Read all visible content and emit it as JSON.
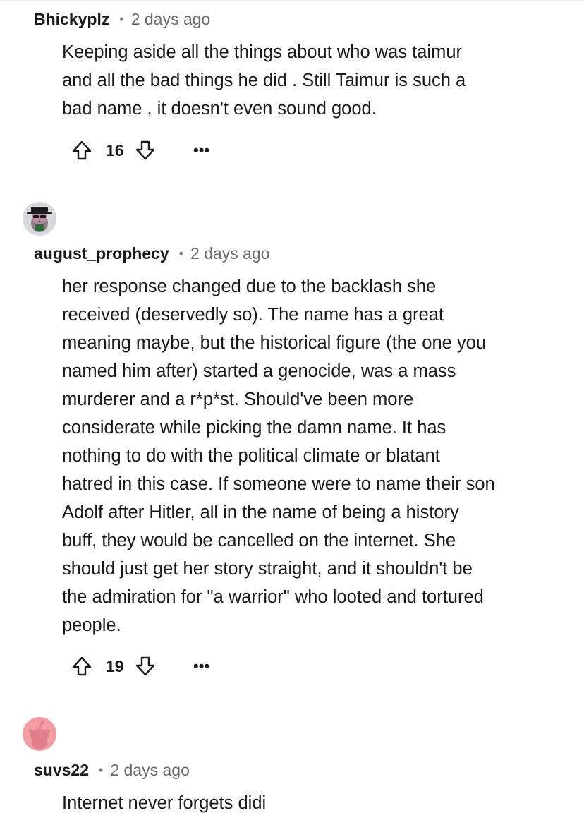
{
  "comments": [
    {
      "author": "Bhickyplz",
      "separator": "•",
      "time": "2 days ago",
      "lines": [
        "Keeping aside all the things about who was taimur",
        "and all the bad things he did . Still Taimur is such a",
        "bad name , it doesn't even sound good."
      ],
      "score": "16",
      "more": "•••"
    },
    {
      "author": "august_prophecy",
      "separator": "•",
      "time": "2 days ago",
      "lines": [
        "her response changed due to the backlash she",
        "received (deservedly so). The name has a great",
        "meaning maybe, but the historical figure (the one you",
        "named him after) started a genocide, was a mass",
        "murderer and a r*p*st. Should've been more",
        "considerate while picking the damn name. It has",
        "nothing to do with the political climate or blatant",
        "hatred in this case. If someone were to name their son",
        "Adolf after Hitler, all in the name of being a history",
        "buff, they would be cancelled on the internet. She",
        "should just get her story straight, and it shouldn't be",
        "the admiration for \"a warrior\" who looted and tortured",
        "people."
      ],
      "score": "19",
      "more": "•••"
    },
    {
      "author": "suvs22",
      "separator": "•",
      "time": "2 days ago",
      "lines": [
        "Internet never forgets didi"
      ]
    }
  ],
  "icons": {
    "upvote": "upvote-arrow-icon",
    "downvote": "downvote-arrow-icon",
    "more": "more-options-icon",
    "avatar2": "snoo-avatar-hat-sunglasses",
    "avatar3": "snoo-avatar-pink"
  },
  "colors": {
    "text": "#1a1a1b",
    "meta": "#6a6a6a",
    "avatar3_bg": "#f39ca4"
  }
}
